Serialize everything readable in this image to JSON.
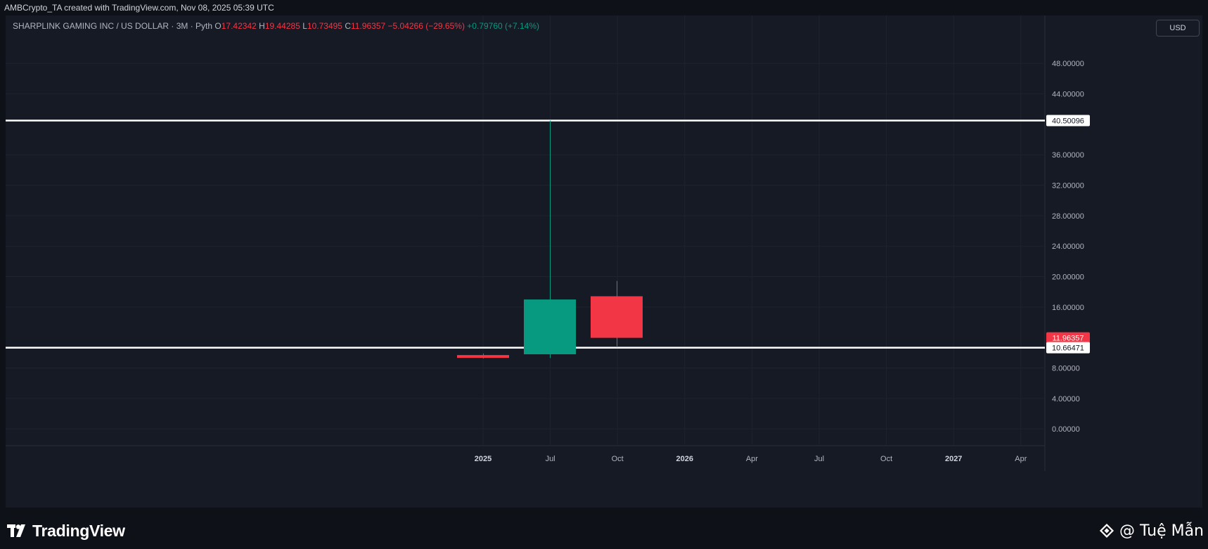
{
  "header": {
    "caption": "AMBCrypto_TA created with TradingView.com, Nov 08, 2025 05:39 UTC"
  },
  "legend": {
    "symbol": "SHARPLINK GAMING INC / US DOLLAR · 3M · Pyth",
    "o_label": "O",
    "o_value": "17.42342",
    "h_label": "H",
    "h_value": "19.44285",
    "l_label": "L",
    "l_value": "10.73495",
    "c_label": "C",
    "c_value": "11.96357",
    "change": "−5.04266 (−29.65%)",
    "extra_change": "+0.79760 (+7.14%)"
  },
  "currency_button": "USD",
  "footer": {
    "brand": "TradingView",
    "author": "@ Tuệ Mẫn"
  },
  "colors": {
    "up": "#089981",
    "down": "#f23645",
    "level_line": "#ffffff",
    "grid": "#1f2330",
    "background": "#161a25",
    "axis_text": "#b2b5be"
  },
  "chart_data": {
    "type": "candlestick",
    "title": "SHARPLINK GAMING INC / US DOLLAR · 3M · Pyth",
    "ylim": [
      -2.2,
      54.3
    ],
    "y_ticks": [
      {
        "value": 0,
        "label": "0.00000"
      },
      {
        "value": 4,
        "label": "4.00000"
      },
      {
        "value": 8,
        "label": "8.00000"
      },
      {
        "value": 16,
        "label": "16.00000"
      },
      {
        "value": 20,
        "label": "20.00000"
      },
      {
        "value": 24,
        "label": "24.00000"
      },
      {
        "value": 28,
        "label": "28.00000"
      },
      {
        "value": 32,
        "label": "32.00000"
      },
      {
        "value": 36,
        "label": "36.00000"
      },
      {
        "value": 44,
        "label": "44.00000"
      },
      {
        "value": 48,
        "label": "48.00000"
      }
    ],
    "x_ticks": [
      {
        "label": "2025",
        "bold": true
      },
      {
        "label": "Jul",
        "bold": false
      },
      {
        "label": "Oct",
        "bold": false
      },
      {
        "label": "2026",
        "bold": true
      },
      {
        "label": "Apr",
        "bold": false
      },
      {
        "label": "Jul",
        "bold": false
      },
      {
        "label": "Oct",
        "bold": false
      },
      {
        "label": "2027",
        "bold": true
      },
      {
        "label": "Apr",
        "bold": false
      }
    ],
    "candles": [
      {
        "period": "2025 Q1",
        "open": 9.7,
        "high": 9.9,
        "low": 9.25,
        "close": 9.4
      },
      {
        "period": "2025 Q2",
        "open": 9.8,
        "high": 40.5,
        "low": 9.3,
        "close": 17.0
      },
      {
        "period": "2025 Q3",
        "open": 17.42342,
        "high": 19.44285,
        "low": 10.73495,
        "close": 11.96357
      }
    ],
    "horizontal_levels": [
      {
        "value": 40.50096,
        "label": "40.50096"
      },
      {
        "value": 10.66471,
        "label": "10.66471"
      }
    ],
    "last_price": {
      "value": 11.96357,
      "label": "11.96357"
    }
  }
}
